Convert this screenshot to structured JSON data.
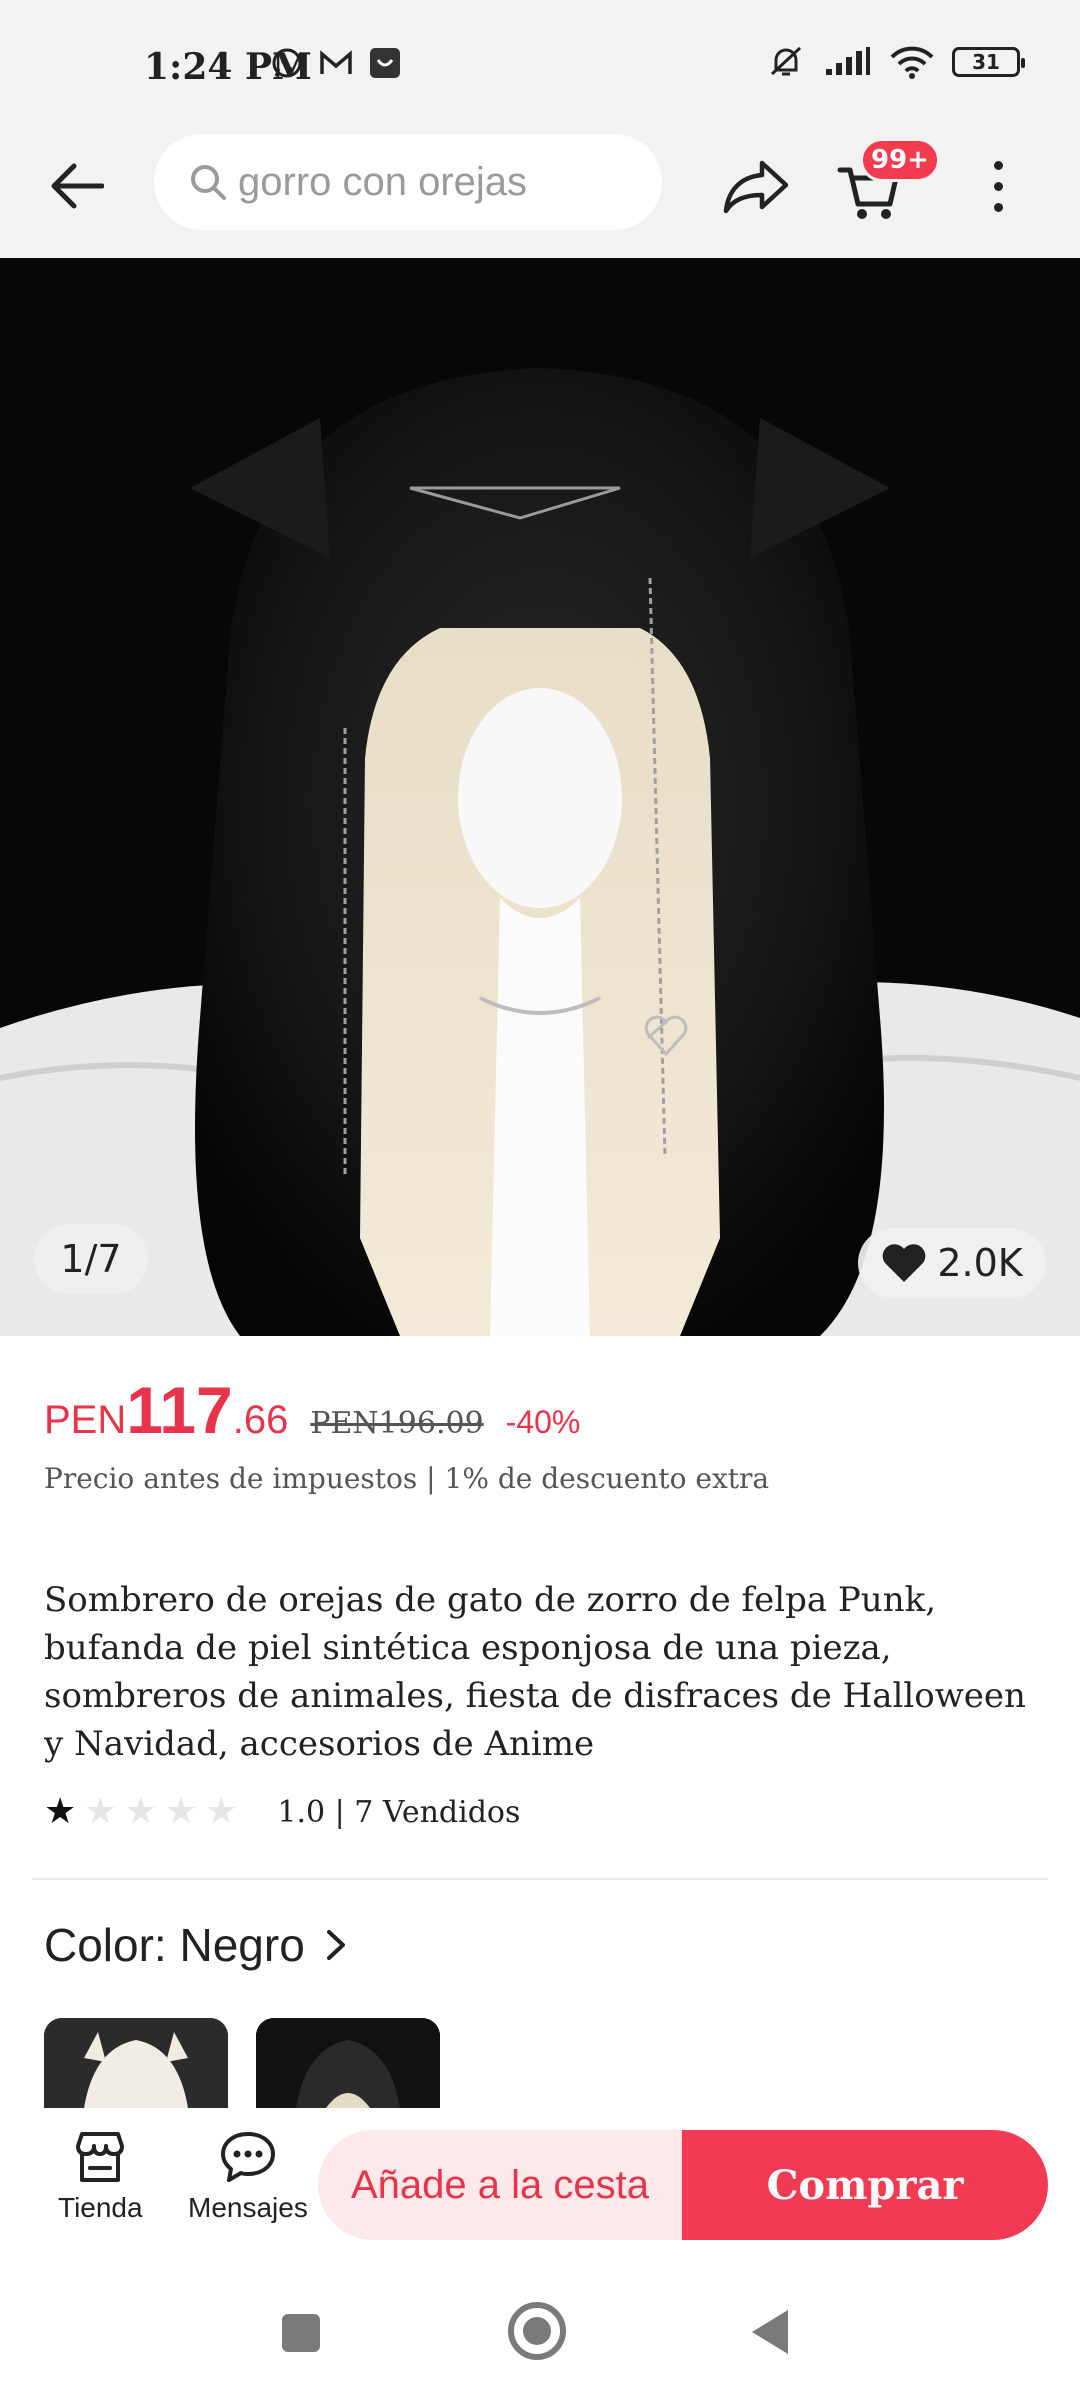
{
  "status_bar": {
    "time": "1:24 PM",
    "battery": "31",
    "icons": [
      "whatsapp-icon",
      "gmail-icon",
      "app-notification-icon",
      "mute-icon",
      "signal-icon",
      "wifi-icon",
      "battery-icon"
    ]
  },
  "nav": {
    "search_placeholder": "gorro con orejas",
    "cart_badge": "99+"
  },
  "image": {
    "counter": "1/7",
    "likes": "2.0K"
  },
  "price": {
    "currency": "PEN",
    "integer": "117",
    "decimal": ".66",
    "original": "PEN196.09",
    "discount": "-40%",
    "note": "Precio antes de impuestos | 1% de descuento extra"
  },
  "product": {
    "title": "Sombrero de orejas de gato de zorro de felpa Punk, bufanda de piel sintética esponjosa de una pieza, sombreros de animales, fiesta de disfraces de Halloween y Navidad, accesorios de Anime",
    "rating_value": 1.0,
    "rating_text": "1.0 | 7 Vendidos",
    "stars_filled": 1,
    "stars_total": 5
  },
  "color": {
    "label": "Color: Negro"
  },
  "bottom_bar": {
    "store_label": "Tienda",
    "messages_label": "Mensajes",
    "add_to_cart_label": "Añade a la cesta",
    "buy_label": "Comprar"
  },
  "colors": {
    "accent": "#e8344a",
    "buy_button": "#f23b52",
    "cart_button_bg": "#fde8ea"
  }
}
